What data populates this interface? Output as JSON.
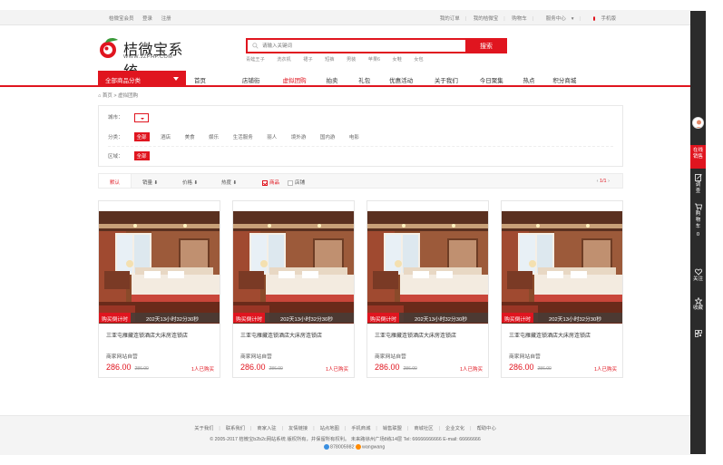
{
  "topbar": {
    "left": [
      "桔微宝会员",
      "登录",
      "注册"
    ],
    "right": [
      "我的订单",
      "我的桔微宝",
      "购物车",
      "服务中心",
      "手机版"
    ]
  },
  "logo": {
    "cn": "桔微宝系统",
    "en": "WWW.JZPHP.COM"
  },
  "search": {
    "placeholder": "请输入关键词",
    "button": "搜索",
    "hotwords": [
      "青蛙王子",
      "洗衣机",
      "裙子",
      "短裤",
      "男装",
      "苹果6",
      "女鞋",
      "女包"
    ]
  },
  "nav": {
    "category": "全部商品分类",
    "items": [
      "首页",
      "店铺街",
      "虚拟团购",
      "拍卖",
      "礼包",
      "优惠活动",
      "关于我们",
      "今日聚集",
      "热点",
      "积分商城"
    ],
    "active_index": 2
  },
  "breadcrumb": {
    "home": "首页",
    "sep": ">",
    "current": "虚拟团购"
  },
  "filter": {
    "city_label": "城市：",
    "category_label": "分类：",
    "categories": [
      "全部",
      "酒店",
      "美食",
      "娱乐",
      "生活服务",
      "丽人",
      "境外游",
      "国内游",
      "电影"
    ],
    "area_label": "区域：",
    "areas": [
      "全部"
    ]
  },
  "sortbar": {
    "default": "默认",
    "sales": "销量",
    "price": "价格",
    "popularity": "热度",
    "goods": "商品",
    "shops": "店铺",
    "pager": "1/1"
  },
  "products": [
    {
      "tag": "购买倒计时",
      "countdown": "202天13小时32分30秒",
      "title": "三亚屯雁藏连锁酒店大床房连锁店",
      "shop": "商家网站自营",
      "price": "286.00",
      "old_price": "286.00",
      "sold": "1人已购买"
    },
    {
      "tag": "购买倒计时",
      "countdown": "202天13小时32分30秒",
      "title": "三亚屯雁藏连锁酒店大床房连锁店",
      "shop": "商家网站自营",
      "price": "286.00",
      "old_price": "286.00",
      "sold": "1人已购买"
    },
    {
      "tag": "购买倒计时",
      "countdown": "202天13小时32分30秒",
      "title": "三亚屯雁藏连锁酒店大床房连锁店",
      "shop": "商家网站自营",
      "price": "286.00",
      "old_price": "286.00",
      "sold": "1人已购买"
    },
    {
      "tag": "购买倒计时",
      "countdown": "202天13小时32分30秒",
      "title": "三亚屯雁藏连锁酒店大床房连锁店",
      "shop": "商家网站自营",
      "price": "286.00",
      "old_price": "286.00",
      "sold": "1人已购买"
    }
  ],
  "footer": {
    "links": [
      "关于我们",
      "联系我们",
      "商家入驻",
      "友情链接",
      "站点地图",
      "手机商城",
      "销售联盟",
      "商城社区",
      "企业文化",
      "帮助中心"
    ],
    "copyright": "© 2005-2017 桔微宝b2b2c网站系统 版权所有，并保留所有权利。 未来路徐州广场8栋14层 Tel: 66666666666 E-mail: 66666666",
    "qq": "878005982",
    "wangwang": "wangwang"
  },
  "sidebar": {
    "online": "在线销售",
    "items": [
      "调查",
      "购物车",
      "0",
      "关注",
      "收藏"
    ]
  },
  "colors": {
    "accent": "#e0151f"
  }
}
